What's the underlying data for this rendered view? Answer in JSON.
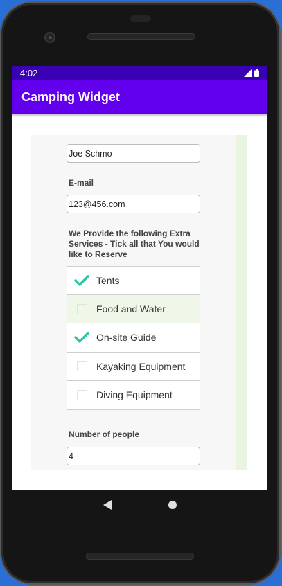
{
  "status_bar": {
    "time": "4:02"
  },
  "app_bar": {
    "title": "Camping Widget"
  },
  "form": {
    "name_value": "Joe Schmo",
    "email_label": "E-mail",
    "email_value": "123@456.com",
    "services_label": "We Provide the following Extra Services - Tick all that You would like to Reserve",
    "services": [
      {
        "label": "Tents",
        "checked": true
      },
      {
        "label": "Food and Water",
        "checked": false
      },
      {
        "label": "On-site Guide",
        "checked": true
      },
      {
        "label": "Kayaking Equipment",
        "checked": false
      },
      {
        "label": "Diving Equipment",
        "checked": false
      }
    ],
    "people_label": "Number of people",
    "people_value": "4"
  },
  "colors": {
    "status_bar": "#3a00b3",
    "app_bar": "#6200ee",
    "check_accent": "#2ec7a6"
  },
  "icons": [
    "signal-icon",
    "battery-icon",
    "checkmark-icon",
    "back-icon",
    "home-icon"
  ]
}
